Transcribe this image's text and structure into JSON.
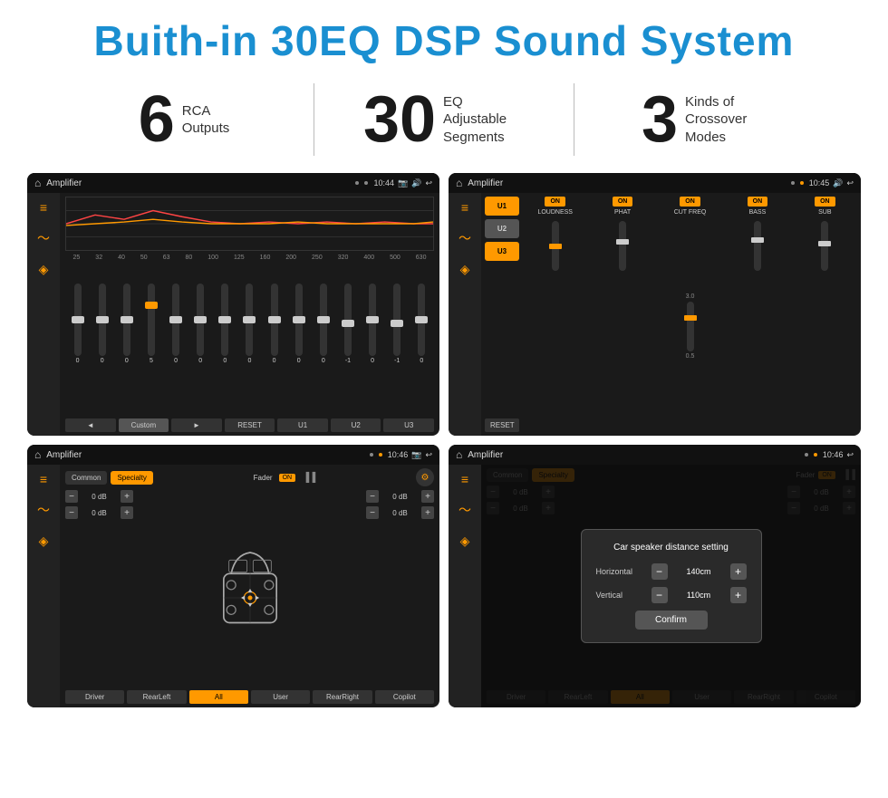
{
  "header": {
    "title": "Buith-in 30EQ DSP Sound System"
  },
  "stats": [
    {
      "number": "6",
      "text_line1": "RCA",
      "text_line2": "Outputs"
    },
    {
      "number": "30",
      "text_line1": "EQ Adjustable",
      "text_line2": "Segments"
    },
    {
      "number": "3",
      "text_line1": "Kinds of",
      "text_line2": "Crossover Modes"
    }
  ],
  "screens": {
    "top_left": {
      "title": "Amplifier",
      "time": "10:44",
      "eq_labels": [
        "25",
        "32",
        "40",
        "50",
        "63",
        "80",
        "100",
        "125",
        "160",
        "200",
        "250",
        "320",
        "400",
        "500",
        "630"
      ],
      "eq_values": [
        "0",
        "0",
        "0",
        "5",
        "0",
        "0",
        "0",
        "0",
        "0",
        "0",
        "0",
        "-1",
        "0",
        "-1"
      ],
      "buttons": [
        "Custom",
        "RESET",
        "U1",
        "U2",
        "U3"
      ]
    },
    "top_right": {
      "title": "Amplifier",
      "time": "10:45",
      "channels": [
        "LOUDNESS",
        "PHAT",
        "CUT FREQ",
        "BASS",
        "SUB"
      ],
      "toggles": [
        "ON",
        "ON",
        "ON",
        "ON",
        "ON"
      ],
      "presets": [
        "U1",
        "U2",
        "U3"
      ],
      "reset": "RESET"
    },
    "bottom_left": {
      "title": "Amplifier",
      "time": "10:46",
      "tabs": [
        "Common",
        "Specialty"
      ],
      "fader": "Fader",
      "fader_on": "ON",
      "controls_left": [
        "0 dB",
        "0 dB"
      ],
      "controls_right": [
        "0 dB",
        "0 dB"
      ],
      "buttons": [
        "Driver",
        "RearLeft",
        "All",
        "User",
        "RearRight",
        "Copilot"
      ]
    },
    "bottom_right": {
      "title": "Amplifier",
      "time": "10:46",
      "tabs": [
        "Common",
        "Specialty"
      ],
      "dialog": {
        "title": "Car speaker distance setting",
        "horizontal_label": "Horizontal",
        "horizontal_value": "140cm",
        "vertical_label": "Vertical",
        "vertical_value": "110cm",
        "confirm_label": "Confirm"
      },
      "buttons": [
        "Driver",
        "RearLeft",
        "All",
        "User",
        "RearRight",
        "Copilot"
      ]
    }
  }
}
